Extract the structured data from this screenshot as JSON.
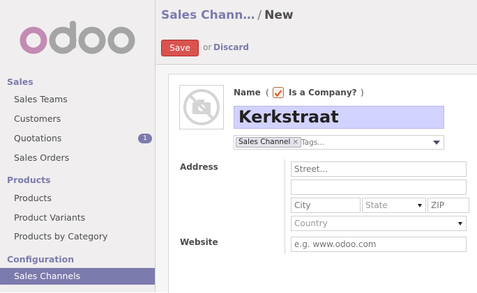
{
  "sidebar": {
    "logo_text": "odoo",
    "sections": [
      {
        "title": "Sales",
        "items": [
          {
            "label": "Sales Teams"
          },
          {
            "label": "Customers"
          },
          {
            "label": "Quotations",
            "badge": "1"
          },
          {
            "label": "Sales Orders"
          }
        ]
      },
      {
        "title": "Products",
        "items": [
          {
            "label": "Products"
          },
          {
            "label": "Product Variants"
          },
          {
            "label": "Products by Category"
          }
        ]
      },
      {
        "title": "Configuration",
        "items": [
          {
            "label": "Sales Channels",
            "active": true
          }
        ]
      }
    ]
  },
  "breadcrumb": {
    "parent": "Sales Chann…",
    "separator": "/",
    "current": "New"
  },
  "actions": {
    "save_label": "Save",
    "or_text": "or",
    "discard_label": "Discard"
  },
  "form": {
    "name_label": "Name",
    "paren_open": "(",
    "paren_close": ")",
    "is_company_label": "Is a Company?",
    "is_company_checked": true,
    "name_value": "Kerkstraat",
    "tags": [
      {
        "label": "Sales Channel",
        "remove": "×"
      }
    ],
    "tags_placeholder": "Tags...",
    "address_label": "Address",
    "street_placeholder": "Street...",
    "street2_placeholder": "",
    "city_placeholder": "City",
    "state_placeholder": "State",
    "zip_placeholder": "ZIP",
    "country_placeholder": "Country",
    "website_label": "Website",
    "website_placeholder": "e.g. www.odoo.com"
  },
  "colors": {
    "accent": "#7c7bad",
    "save": "#d9534f",
    "sidebar_bg": "#f0eeee"
  }
}
